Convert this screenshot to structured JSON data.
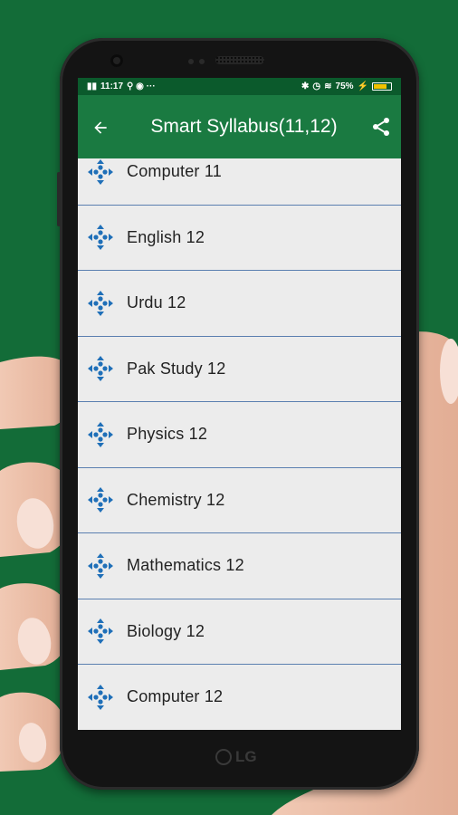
{
  "status_bar": {
    "left_icons": "📶 4G",
    "time": "11:17",
    "right_text": "75%",
    "battery_level": 0.75
  },
  "app_bar": {
    "title": "Smart Syllabus(11,12)",
    "back_icon": "arrow-left-icon",
    "share_icon": "share-icon"
  },
  "subjects": [
    {
      "label": "Computer 11"
    },
    {
      "label": "English 12"
    },
    {
      "label": "Urdu 12"
    },
    {
      "label": "Pak Study 12"
    },
    {
      "label": "Physics 12"
    },
    {
      "label": "Chemistry 12"
    },
    {
      "label": "Mathematics 12"
    },
    {
      "label": "Biology 12"
    },
    {
      "label": "Computer 12"
    }
  ],
  "device": {
    "brand": "LG"
  },
  "colors": {
    "background": "#136c38",
    "app_bar": "#1a7a41",
    "status_bar": "#0b5a2c",
    "icon": "#1f6fb8",
    "divider": "#5b7fb0"
  }
}
